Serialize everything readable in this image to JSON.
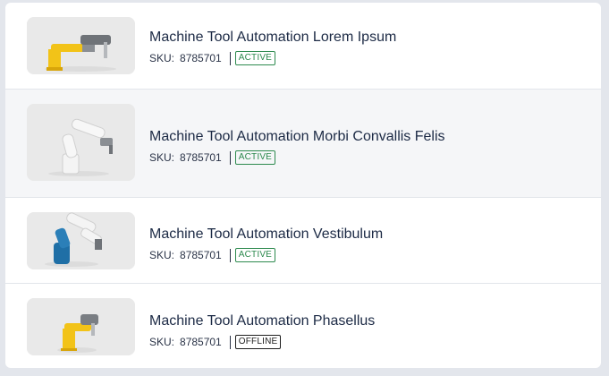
{
  "products": [
    {
      "title": "Machine Tool Automation Lorem Ipsum",
      "sku_label": "SKU:",
      "sku": "8785701",
      "status": "ACTIVE",
      "image_icon": "scara-robot-yellow-icon"
    },
    {
      "title": "Machine Tool Automation Morbi Convallis Felis",
      "sku_label": "SKU:",
      "sku": "8785701",
      "status": "ACTIVE",
      "image_icon": "articulated-robot-white-icon"
    },
    {
      "title": "Machine Tool Automation Vestibulum",
      "sku_label": "SKU:",
      "sku": "8785701",
      "status": "ACTIVE",
      "image_icon": "articulated-robot-blue-icon"
    },
    {
      "title": "Machine Tool Automation Phasellus",
      "sku_label": "SKU:",
      "sku": "8785701",
      "status": "OFFLINE",
      "image_icon": "scara-robot-yellow-small-icon"
    }
  ],
  "colors": {
    "active": "#2d8a4e",
    "offline": "#1f1f1f",
    "robot_yellow": "#f2c318",
    "robot_blue": "#1f6fa6"
  }
}
